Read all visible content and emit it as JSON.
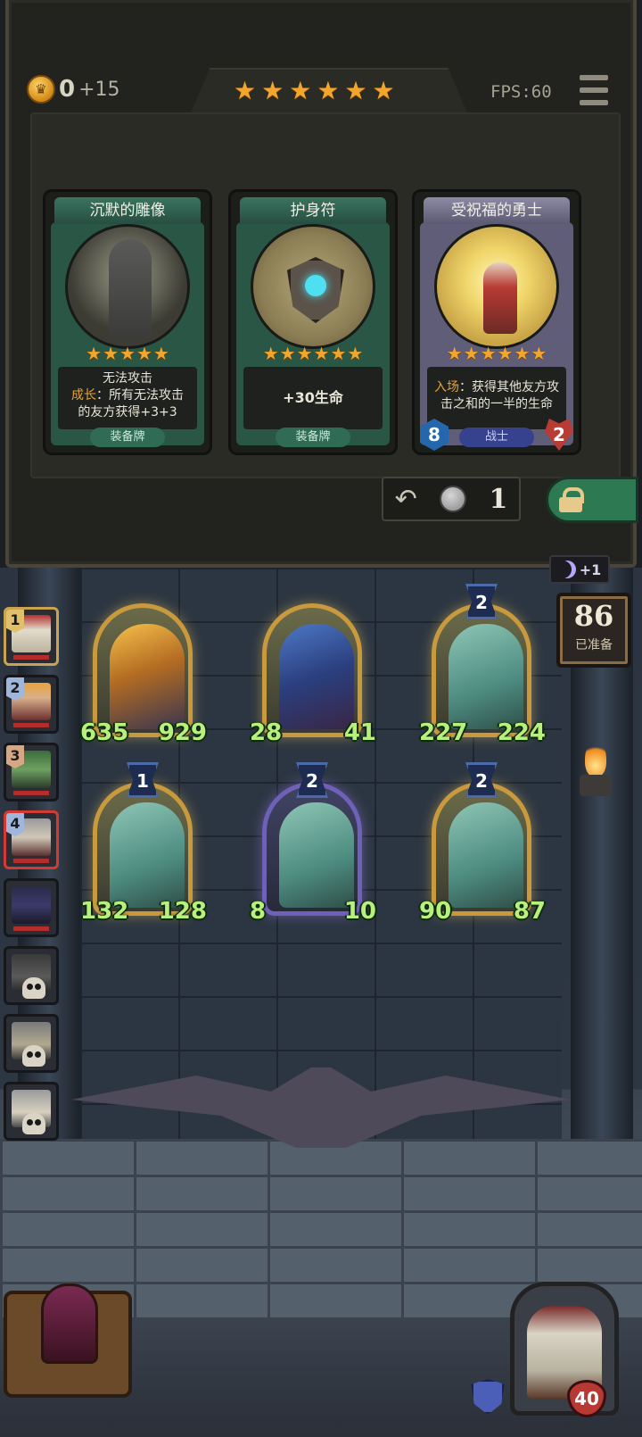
{
  "header": {
    "gold": "0",
    "gold_bonus": "+15",
    "tavern_stars": 6,
    "fps": "FPS:60"
  },
  "shop_cards": [
    {
      "title": "沉默的雕像",
      "stars": 5,
      "desc_lines": [
        "无法攻击"
      ],
      "desc_keyword": "成长",
      "desc_rest": "：所有无法攻击",
      "desc_last": "的友方获得+3+3",
      "tag": "装备牌",
      "color": "green"
    },
    {
      "title": "护身符",
      "stars": 6,
      "desc_single": "+30生命",
      "tag": "装备牌",
      "color": "green"
    },
    {
      "title": "受祝福的勇士",
      "stars": 6,
      "desc_keyword": "入场",
      "desc_rest": "：获得其他友方攻",
      "desc_last": "击之和的一半的生命",
      "tag": "战士",
      "attack": "8",
      "health": "2",
      "color": "purple"
    }
  ],
  "shop_controls": {
    "refresh_cost": "1"
  },
  "side_info": {
    "moon_bonus": "+1",
    "ready_count": "86",
    "ready_label": "已准备"
  },
  "roster": [
    {
      "rank": "1",
      "state": "selected"
    },
    {
      "rank": "2",
      "state": "normal"
    },
    {
      "rank": "3",
      "state": "normal"
    },
    {
      "rank": "4",
      "state": "danger"
    },
    {
      "rank": "",
      "state": "normal"
    },
    {
      "rank": "",
      "state": "dead"
    },
    {
      "rank": "",
      "state": "dead"
    },
    {
      "rank": "",
      "state": "dead"
    }
  ],
  "board_minions": [
    {
      "name": "blonde-hero",
      "attack": "635",
      "health": "929",
      "tier": "",
      "style": "gold"
    },
    {
      "name": "blue-hair-sorceress",
      "attack": "28",
      "health": "41",
      "tier": "",
      "style": "gold"
    },
    {
      "name": "spirit-horse",
      "attack": "227",
      "health": "224",
      "tier": "2",
      "style": "gold"
    },
    {
      "name": "spirit-horse",
      "attack": "132",
      "health": "128",
      "tier": "1",
      "style": "gold"
    },
    {
      "name": "spirit-horse",
      "attack": "8",
      "health": "10",
      "tier": "2",
      "style": "purple"
    },
    {
      "name": "spirit-horse",
      "attack": "90",
      "health": "87",
      "tier": "2",
      "style": "gold"
    }
  ],
  "player": {
    "health": "40"
  },
  "colors": {
    "star": "#f3a52c",
    "stat_green": "#b8f07e",
    "card_green": "#2a5646",
    "card_purple": "#5f5d78"
  }
}
